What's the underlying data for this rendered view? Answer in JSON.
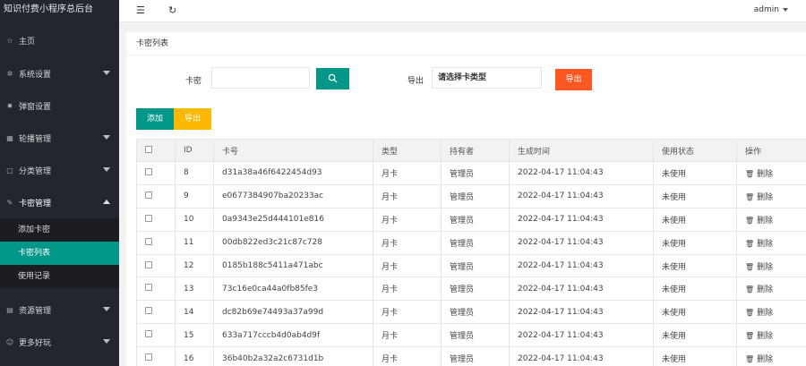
{
  "brand": "知识付费小程序总后台",
  "sidebar": {
    "items": [
      {
        "label": "主页",
        "icon": "home-icon"
      },
      {
        "label": "系统设置",
        "icon": "gear-icon"
      },
      {
        "label": "弹窗设置",
        "icon": "popup-icon"
      },
      {
        "label": "轮播管理",
        "icon": "carousel-icon"
      },
      {
        "label": "分类管理",
        "icon": "category-icon"
      },
      {
        "label": "卡密管理",
        "icon": "card-icon"
      }
    ],
    "sub_items": [
      {
        "label": "添加卡密"
      },
      {
        "label": "卡密列表"
      },
      {
        "label": "使用记录"
      }
    ],
    "bottom_items": [
      {
        "label": "资源管理",
        "icon": "resource-icon"
      },
      {
        "label": "更多好玩",
        "icon": "more-icon"
      }
    ]
  },
  "header": {
    "user": "admin"
  },
  "panel": {
    "title": "卡密列表"
  },
  "filters": {
    "card_label": "卡密",
    "card_value": "",
    "export_label": "导出",
    "type_value": "请选择卡类型",
    "export_button": "导出"
  },
  "actions": {
    "add": "添加",
    "export": "导出"
  },
  "table": {
    "headers": [
      "ID",
      "卡号",
      "类型",
      "持有者",
      "生成时间",
      "使用状态",
      "操作"
    ],
    "rows": [
      {
        "id": "8",
        "card": "d31a38a46f6422454d93",
        "type": "月卡",
        "owner": "管理员",
        "time": "2022-04-17 11:04:43",
        "status": "未使用",
        "op": "删除"
      },
      {
        "id": "9",
        "card": "e0677384907ba20233ac",
        "type": "月卡",
        "owner": "管理员",
        "time": "2022-04-17 11:04:43",
        "status": "未使用",
        "op": "删除"
      },
      {
        "id": "10",
        "card": "0a9343e25d444101e816",
        "type": "月卡",
        "owner": "管理员",
        "time": "2022-04-17 11:04:43",
        "status": "未使用",
        "op": "删除"
      },
      {
        "id": "11",
        "card": "00db822ed3c21c87c728",
        "type": "月卡",
        "owner": "管理员",
        "time": "2022-04-17 11:04:43",
        "status": "未使用",
        "op": "删除"
      },
      {
        "id": "12",
        "card": "0185b188c5411a471abc",
        "type": "月卡",
        "owner": "管理员",
        "time": "2022-04-17 11:04:43",
        "status": "未使用",
        "op": "删除"
      },
      {
        "id": "13",
        "card": "73c16e0ca44a0fb85fe3",
        "type": "月卡",
        "owner": "管理员",
        "time": "2022-04-17 11:04:43",
        "status": "未使用",
        "op": "删除"
      },
      {
        "id": "14",
        "card": "dc82b69e74493a37a99d",
        "type": "月卡",
        "owner": "管理员",
        "time": "2022-04-17 11:04:43",
        "status": "未使用",
        "op": "删除"
      },
      {
        "id": "15",
        "card": "633a717cccb4d0ab4d9f",
        "type": "月卡",
        "owner": "管理员",
        "time": "2022-04-17 11:04:43",
        "status": "未使用",
        "op": "删除"
      },
      {
        "id": "16",
        "card": "36b40b2a32a2c6731d1b",
        "type": "月卡",
        "owner": "管理员",
        "time": "2022-04-17 11:04:43",
        "status": "未使用",
        "op": "删除"
      }
    ]
  },
  "colors": {
    "sidebar_bg": "#23262e",
    "accent": "#009688",
    "danger": "#ff5722",
    "warning": "#ffb800"
  }
}
